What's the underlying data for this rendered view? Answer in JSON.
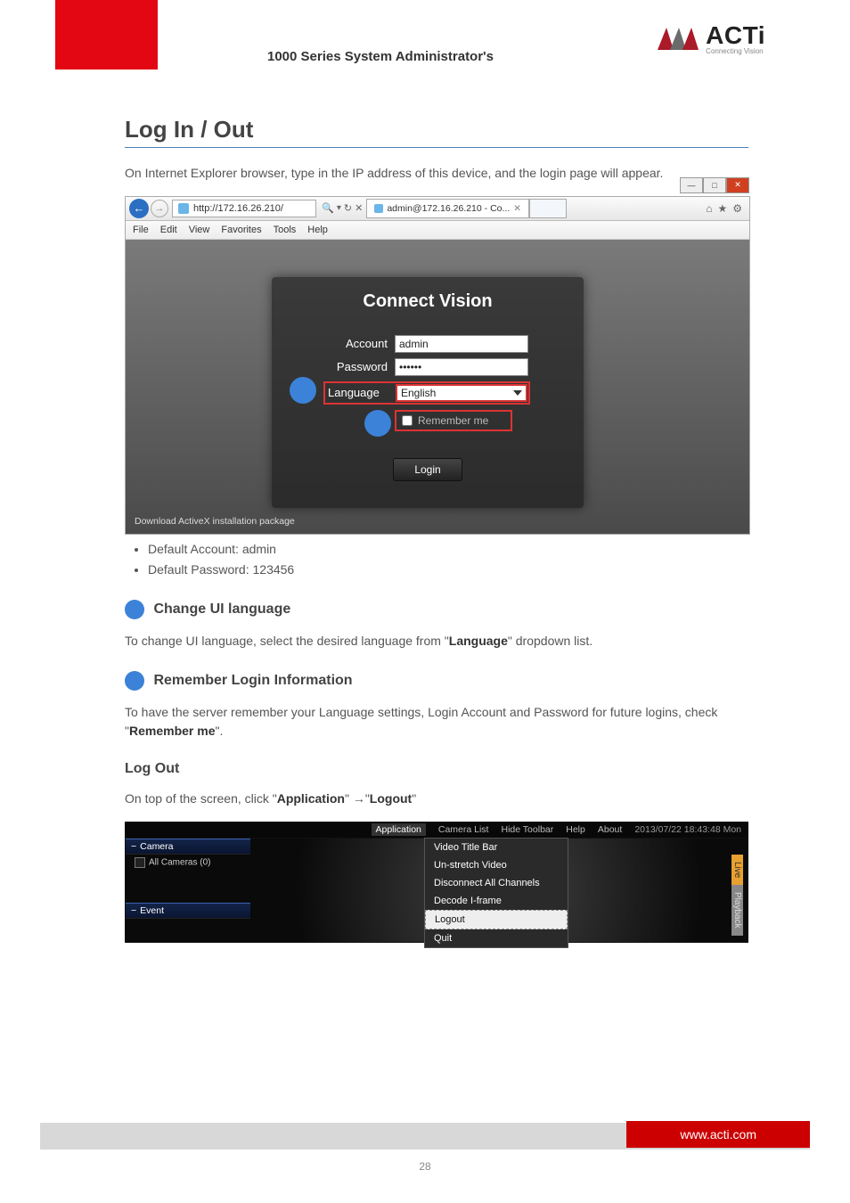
{
  "header": {
    "title_line": "1000 Series System Administrator's",
    "logo_text": "ACTi",
    "logo_sub": "Connecting Vision"
  },
  "section": {
    "heading": "Log In / Out",
    "intro": "On Internet Explorer browser, type in the IP address of this device, and the login page will appear.",
    "screenshot": {
      "url": "http://172.16.26.210/",
      "tab_title": "admin@172.16.26.210 - Co...",
      "ie_menu": [
        "File",
        "Edit",
        "View",
        "Favorites",
        "Tools",
        "Help"
      ],
      "login_card": {
        "title": "Connect Vision",
        "account_label": "Account",
        "account_value": "admin",
        "password_label": "Password",
        "password_value": "••••••",
        "language_label": "Language",
        "language_value": "English",
        "remember_label": "Remember me",
        "login_button": "Login"
      },
      "download_text": "Download ActiveX installation package"
    },
    "below_screenshot": {
      "bullet1": "Default Account: admin",
      "bullet2": "Default Password: 123456",
      "change_ui_lang_head": "Change UI language",
      "change_ui_lang_text_a": "To ",
      "change_ui_lang_text_b": "change UI language, select the desired language from \"",
      "language_word": "Language",
      "change_ui_lang_text_c": "\" dropdown list.",
      "remember_head": "Remember Login Information",
      "remember_text_a": "To have the server remember your Language settings, Login Account and Password for future logins, check \"",
      "remember_word": "Remember me",
      "remember_text_b": "\".",
      "logout_head": "Log Out",
      "logout_text_a": "On top of the screen, click \"",
      "logout_text_app": "Application",
      "logout_arrow": "→",
      "logout_text_logout": "Logout",
      "logout_text_b": "\""
    },
    "app_shot": {
      "topbar": [
        "Application",
        "Camera List",
        "Hide Toolbar",
        "Help",
        "About"
      ],
      "timestamp": "2013/07/22 18:43:48 Mon",
      "sidebar": {
        "camera_head": "Camera",
        "all_cams": "All Cameras (0)",
        "event_head": "Event"
      },
      "menu_items": [
        "Video Title Bar",
        "Un-stretch Video",
        "Disconnect All Channels",
        "Decode I-frame",
        "Logout",
        "Quit"
      ],
      "right_tabs": {
        "live": "Live",
        "playback": "Playback"
      }
    }
  },
  "footer": {
    "url": "www.acti.com",
    "page": "28"
  }
}
